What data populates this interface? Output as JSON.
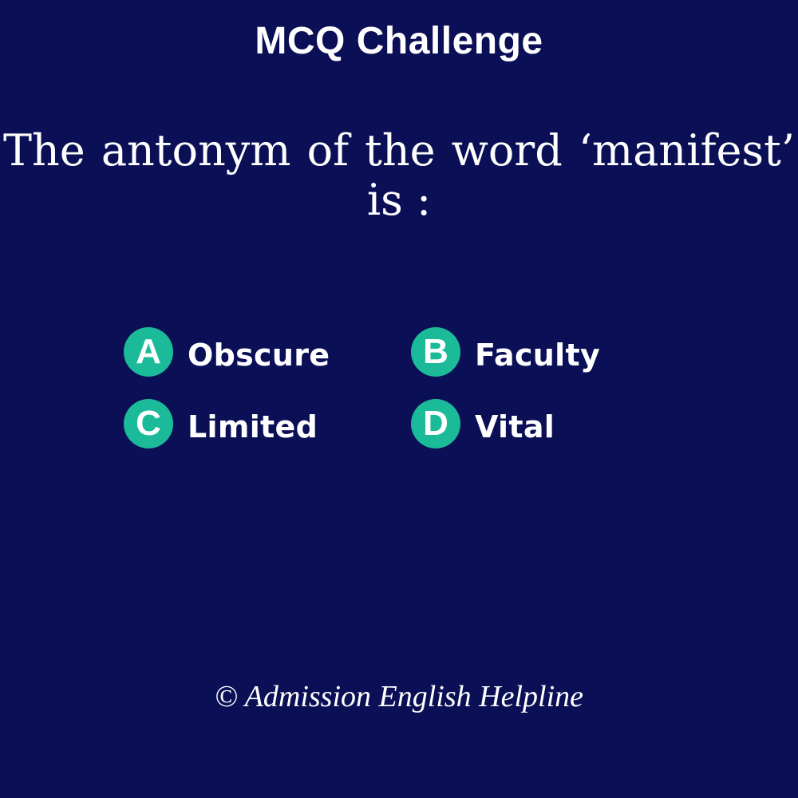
{
  "header": {
    "title": "MCQ Challenge"
  },
  "question": {
    "text": "The antonym of the word ‘manifest’ is :"
  },
  "options": [
    {
      "letter": "A",
      "text": "Obscure"
    },
    {
      "letter": "B",
      "text": "Faculty"
    },
    {
      "letter": "C",
      "text": "Limited"
    },
    {
      "letter": "D",
      "text": "Vital"
    }
  ],
  "footer": {
    "copyright": "© Admission English Helpline"
  },
  "colors": {
    "background": "#0a0f56",
    "badge": "#1bbb99",
    "text": "#ffffff"
  }
}
